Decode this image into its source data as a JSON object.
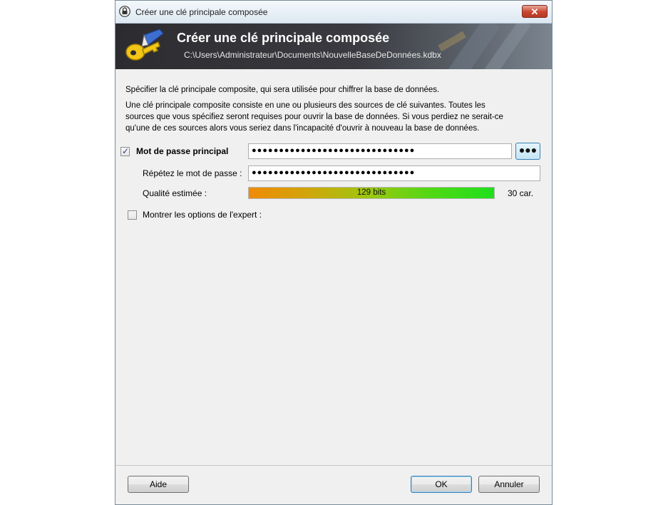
{
  "window": {
    "title": "Créer une clé principale composée"
  },
  "banner": {
    "title": "Créer une clé principale composée",
    "path": "C:\\Users\\Administrateur\\Documents\\NouvelleBaseDeDonnées.kdbx"
  },
  "intro": {
    "line1": "Spécifier la clé principale composite, qui sera utilisée pour chiffrer la base de données.",
    "para_lines": [
      "Une clé principale composite consiste en une ou plusieurs des sources de clé suivantes. Toutes les",
      "sources que vous spécifiez seront requises pour ouvrir la base de données. Si vous perdiez ne serait-ce",
      "qu'une de ces sources alors vous seriez dans l'incapacité d'ouvrir à nouveau la base de données."
    ]
  },
  "password": {
    "checked": true,
    "label": "Mot de passe principal",
    "value": "●●●●●●●●●●●●●●●●●●●●●●●●●●●●●●",
    "toggle_label": "●●●",
    "repeat_label": "Répétez le mot de passe :",
    "repeat_value": "●●●●●●●●●●●●●●●●●●●●●●●●●●●●●●",
    "quality_label": "Qualité estimée :",
    "quality_text": "129 bits",
    "quality_fraction": 1.0,
    "length_text": "30 car."
  },
  "expert": {
    "checked": false,
    "label": "Montrer les options de l'expert :"
  },
  "buttons": {
    "help": "Aide",
    "ok": "OK",
    "cancel": "Annuler"
  },
  "icons": {
    "app": "lock-icon",
    "close": "close-icon",
    "banner": "keys-icon"
  },
  "colors": {
    "banner_dark": "#2c2c30",
    "quality_start": "#ef8a08",
    "quality_end": "#1fdf1b",
    "close_red": "#c9432f"
  }
}
